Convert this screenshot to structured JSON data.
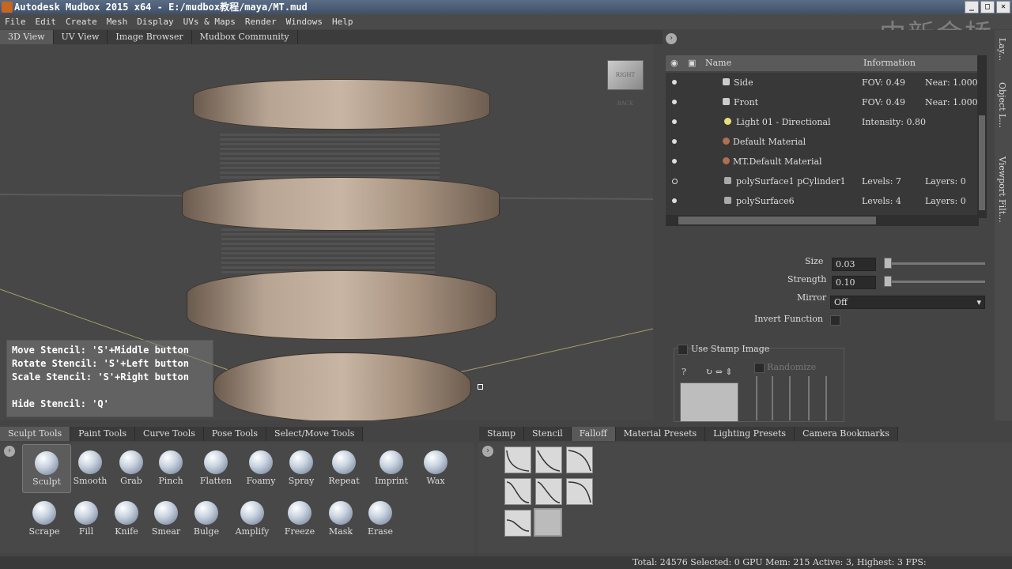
{
  "window": {
    "title": "Autodesk Mudbox 2015 x64 - E:/mudbox教程/maya/MT.mud",
    "watermark": "中新金桥"
  },
  "menu": [
    "File",
    "Edit",
    "Create",
    "Mesh",
    "Display",
    "UVs & Maps",
    "Render",
    "Windows",
    "Help"
  ],
  "view_tabs": [
    {
      "label": "3D View",
      "active": true
    },
    {
      "label": "UV View",
      "active": false
    },
    {
      "label": "Image Browser",
      "active": false
    },
    {
      "label": "Mudbox Community",
      "active": false
    }
  ],
  "nav_cube": {
    "left": "RIGHT",
    "right": "BACK"
  },
  "stencil_help": [
    "Move Stencil: 'S'+Middle button",
    "Rotate Stencil: 'S'+Left button",
    "Scale Stencil: 'S'+Right button",
    "",
    "Hide Stencil: 'Q'"
  ],
  "object_list": {
    "columns": {
      "name": "Name",
      "info": "Information"
    },
    "rows": [
      {
        "name": "Side",
        "info": "FOV: 0.49",
        "info2": "Near: 1.000",
        "icon": "camera-icon",
        "vis": true
      },
      {
        "name": "Front",
        "info": "FOV: 0.49",
        "info2": "Near: 1.000",
        "icon": "camera-icon",
        "vis": true
      },
      {
        "name": "Light 01 - Directional",
        "info": "Intensity: 0.80",
        "info2": "",
        "icon": "light-icon",
        "vis": true
      },
      {
        "name": "Default Material",
        "info": "",
        "info2": "",
        "icon": "material-icon",
        "vis": true
      },
      {
        "name": "MT.Default Material",
        "info": "",
        "info2": "",
        "icon": "material-icon",
        "vis": true
      },
      {
        "name": "polySurface1 pCylinder1",
        "info": "Levels: 7",
        "info2": "Layers: 0",
        "icon": "mesh-icon",
        "vis": false
      },
      {
        "name": "polySurface6",
        "info": "Levels: 4",
        "info2": "Layers: 0",
        "icon": "mesh-icon",
        "vis": true
      }
    ]
  },
  "side_tabs": [
    "Lay...",
    "Object L...",
    "Viewport Filt..."
  ],
  "properties": {
    "size_label": "Size",
    "size_value": "0.03",
    "strength_label": "Strength",
    "strength_value": "0.10",
    "mirror_label": "Mirror",
    "mirror_value": "Off",
    "invert_label": "Invert Function",
    "stamp_label": "Use Stamp Image",
    "randomize_label": "Randomize"
  },
  "sculpt_tabs": [
    {
      "label": "Sculpt Tools",
      "active": true
    },
    {
      "label": "Paint Tools",
      "active": false
    },
    {
      "label": "Curve Tools",
      "active": false
    },
    {
      "label": "Pose Tools",
      "active": false
    },
    {
      "label": "Select/Move Tools",
      "active": false
    }
  ],
  "tools_row1": [
    "Sculpt",
    "Smooth",
    "Grab",
    "Pinch",
    "Flatten",
    "Foamy",
    "Spray",
    "Repeat",
    "Imprint",
    "Wax"
  ],
  "tools_row2": [
    "Scrape",
    "Fill",
    "Knife",
    "Smear",
    "Bulge",
    "Amplify",
    "Freeze",
    "Mask",
    "Erase"
  ],
  "right_tabs": [
    {
      "label": "Stamp",
      "active": false
    },
    {
      "label": "Stencil",
      "active": false
    },
    {
      "label": "Falloff",
      "active": true
    },
    {
      "label": "Material Presets",
      "active": false
    },
    {
      "label": "Lighting Presets",
      "active": false
    },
    {
      "label": "Camera Bookmarks",
      "active": false
    }
  ],
  "status": "Total: 24576   Selected: 0 GPU Mem: 215   Active: 3, Highest: 3   FPS:"
}
